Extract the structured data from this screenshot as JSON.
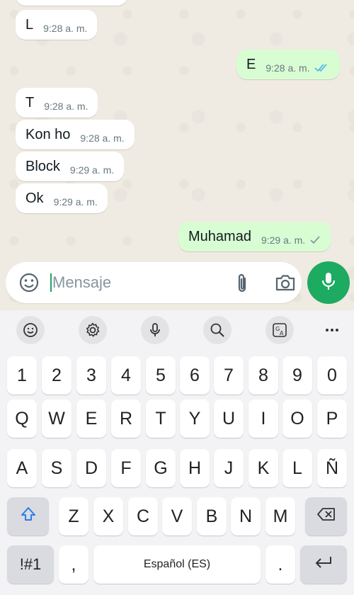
{
  "messages": [
    {
      "text": "L",
      "time": "9:28 a. m.",
      "direction": "in"
    },
    {
      "text": "E",
      "time": "9:28 a. m.",
      "direction": "out",
      "status": "read"
    },
    {
      "text": "T",
      "time": "9:28 a. m.",
      "direction": "in"
    },
    {
      "text": "Kon ho",
      "time": "9:28 a. m.",
      "direction": "in"
    },
    {
      "text": "Block",
      "time": "9:29 a. m.",
      "direction": "in"
    },
    {
      "text": "Ok",
      "time": "9:29 a. m.",
      "direction": "in"
    },
    {
      "text": "Muhamad",
      "time": "9:29 a. m.",
      "direction": "out",
      "status": "sent"
    }
  ],
  "composer": {
    "placeholder": "Mensaje",
    "icons": [
      "emoji-icon",
      "attach-icon",
      "camera-icon"
    ],
    "send_icon": "mic-icon"
  },
  "colors": {
    "accent_green": "#1daa61",
    "outgoing_bubble": "#d9fdd3",
    "read_tick": "#53bdeb"
  },
  "keyboard": {
    "toolbar": [
      "emoji-icon",
      "settings-icon",
      "voice-input-icon",
      "search-icon",
      "translate-icon",
      "more-icon"
    ],
    "row_numbers": [
      "1",
      "2",
      "3",
      "4",
      "5",
      "6",
      "7",
      "8",
      "9",
      "0"
    ],
    "row1": [
      "Q",
      "W",
      "E",
      "R",
      "T",
      "Y",
      "U",
      "I",
      "O",
      "P"
    ],
    "row2": [
      "A",
      "S",
      "D",
      "F",
      "G",
      "H",
      "J",
      "K",
      "L",
      "Ñ"
    ],
    "row3": [
      "Z",
      "X",
      "C",
      "V",
      "B",
      "N",
      "M"
    ],
    "symbols_label": "!#1",
    "comma_label": ",",
    "space_label": "Español (ES)",
    "period_label": "."
  }
}
